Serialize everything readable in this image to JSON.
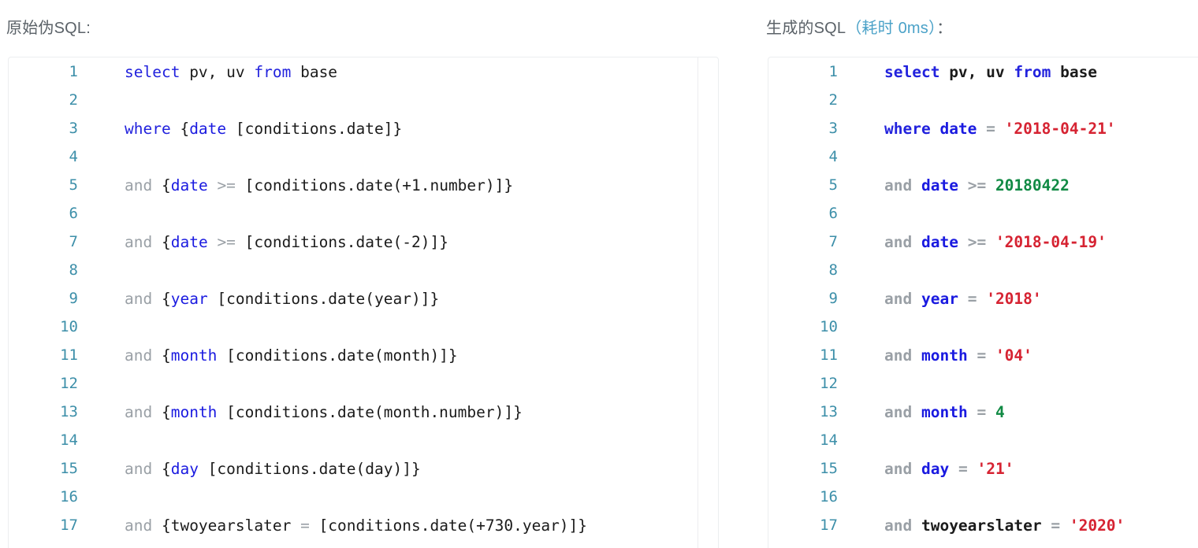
{
  "left_panel": {
    "title": "原始伪SQL：",
    "title_plain": "原始伪SQL:",
    "code_lines": [
      {
        "num": "1",
        "tokens": [
          {
            "t": "select",
            "c": "kw"
          },
          {
            "t": " pv, uv ",
            "c": "plain"
          },
          {
            "t": "from",
            "c": "kw"
          },
          {
            "t": " base",
            "c": "plain"
          }
        ]
      },
      {
        "num": "2",
        "tokens": []
      },
      {
        "num": "3",
        "tokens": [
          {
            "t": "where",
            "c": "kw"
          },
          {
            "t": " {",
            "c": "punc"
          },
          {
            "t": "date",
            "c": "field"
          },
          {
            "t": " [conditions.date]}",
            "c": "punc"
          }
        ]
      },
      {
        "num": "4",
        "tokens": []
      },
      {
        "num": "5",
        "tokens": [
          {
            "t": "and",
            "c": "and"
          },
          {
            "t": " {",
            "c": "punc"
          },
          {
            "t": "date",
            "c": "field"
          },
          {
            "t": " ",
            "c": "plain"
          },
          {
            "t": ">=",
            "c": "op"
          },
          {
            "t": " [conditions.date(+1.number)]}",
            "c": "punc"
          }
        ]
      },
      {
        "num": "6",
        "tokens": []
      },
      {
        "num": "7",
        "tokens": [
          {
            "t": "and",
            "c": "and"
          },
          {
            "t": " {",
            "c": "punc"
          },
          {
            "t": "date",
            "c": "field"
          },
          {
            "t": " ",
            "c": "plain"
          },
          {
            "t": ">=",
            "c": "op"
          },
          {
            "t": " [conditions.date(-2)]}",
            "c": "punc"
          }
        ]
      },
      {
        "num": "8",
        "tokens": []
      },
      {
        "num": "9",
        "tokens": [
          {
            "t": "and",
            "c": "and"
          },
          {
            "t": " {",
            "c": "punc"
          },
          {
            "t": "year",
            "c": "field"
          },
          {
            "t": " [conditions.date(year)]}",
            "c": "punc"
          }
        ]
      },
      {
        "num": "10",
        "tokens": []
      },
      {
        "num": "11",
        "tokens": [
          {
            "t": "and",
            "c": "and"
          },
          {
            "t": " {",
            "c": "punc"
          },
          {
            "t": "month",
            "c": "field"
          },
          {
            "t": " [conditions.date(month)]}",
            "c": "punc"
          }
        ]
      },
      {
        "num": "12",
        "tokens": []
      },
      {
        "num": "13",
        "tokens": [
          {
            "t": "and",
            "c": "and"
          },
          {
            "t": " {",
            "c": "punc"
          },
          {
            "t": "month",
            "c": "field"
          },
          {
            "t": " [conditions.date(month.number)]}",
            "c": "punc"
          }
        ]
      },
      {
        "num": "14",
        "tokens": []
      },
      {
        "num": "15",
        "tokens": [
          {
            "t": "and",
            "c": "and"
          },
          {
            "t": " {",
            "c": "punc"
          },
          {
            "t": "day",
            "c": "field"
          },
          {
            "t": " [conditions.date(day)]}",
            "c": "punc"
          }
        ]
      },
      {
        "num": "16",
        "tokens": []
      },
      {
        "num": "17",
        "tokens": [
          {
            "t": "and",
            "c": "and"
          },
          {
            "t": " {twoyearslater ",
            "c": "punc"
          },
          {
            "t": "=",
            "c": "op"
          },
          {
            "t": " [conditions.date(+730.year)]}",
            "c": "punc"
          }
        ]
      }
    ]
  },
  "right_panel": {
    "title_main": "生成的SQL",
    "title_accent": "（耗时 0ms）",
    "title_suffix": "：",
    "elapsed_ms": "0ms",
    "code_lines": [
      {
        "num": "1",
        "tokens": [
          {
            "t": "select",
            "c": "kw"
          },
          {
            "t": " pv, uv ",
            "c": "plain"
          },
          {
            "t": "from",
            "c": "kw"
          },
          {
            "t": " base",
            "c": "plain"
          }
        ]
      },
      {
        "num": "2",
        "tokens": []
      },
      {
        "num": "3",
        "tokens": [
          {
            "t": "where",
            "c": "kw"
          },
          {
            "t": " ",
            "c": "plain"
          },
          {
            "t": "date",
            "c": "field"
          },
          {
            "t": " ",
            "c": "plain"
          },
          {
            "t": "=",
            "c": "op"
          },
          {
            "t": " ",
            "c": "plain"
          },
          {
            "t": "'2018-04-21'",
            "c": "str"
          }
        ]
      },
      {
        "num": "4",
        "tokens": []
      },
      {
        "num": "5",
        "tokens": [
          {
            "t": "and",
            "c": "and"
          },
          {
            "t": " ",
            "c": "plain"
          },
          {
            "t": "date",
            "c": "field"
          },
          {
            "t": " ",
            "c": "plain"
          },
          {
            "t": ">=",
            "c": "op"
          },
          {
            "t": " ",
            "c": "plain"
          },
          {
            "t": "20180422",
            "c": "num"
          }
        ]
      },
      {
        "num": "6",
        "tokens": []
      },
      {
        "num": "7",
        "tokens": [
          {
            "t": "and",
            "c": "and"
          },
          {
            "t": " ",
            "c": "plain"
          },
          {
            "t": "date",
            "c": "field"
          },
          {
            "t": " ",
            "c": "plain"
          },
          {
            "t": ">=",
            "c": "op"
          },
          {
            "t": " ",
            "c": "plain"
          },
          {
            "t": "'2018-04-19'",
            "c": "str"
          }
        ]
      },
      {
        "num": "8",
        "tokens": []
      },
      {
        "num": "9",
        "tokens": [
          {
            "t": "and",
            "c": "and"
          },
          {
            "t": " ",
            "c": "plain"
          },
          {
            "t": "year",
            "c": "field"
          },
          {
            "t": " ",
            "c": "plain"
          },
          {
            "t": "=",
            "c": "op"
          },
          {
            "t": " ",
            "c": "plain"
          },
          {
            "t": "'2018'",
            "c": "str"
          }
        ]
      },
      {
        "num": "10",
        "tokens": []
      },
      {
        "num": "11",
        "tokens": [
          {
            "t": "and",
            "c": "and"
          },
          {
            "t": " ",
            "c": "plain"
          },
          {
            "t": "month",
            "c": "field"
          },
          {
            "t": " ",
            "c": "plain"
          },
          {
            "t": "=",
            "c": "op"
          },
          {
            "t": " ",
            "c": "plain"
          },
          {
            "t": "'04'",
            "c": "str"
          }
        ]
      },
      {
        "num": "12",
        "tokens": []
      },
      {
        "num": "13",
        "tokens": [
          {
            "t": "and",
            "c": "and"
          },
          {
            "t": " ",
            "c": "plain"
          },
          {
            "t": "month",
            "c": "field"
          },
          {
            "t": " ",
            "c": "plain"
          },
          {
            "t": "=",
            "c": "op"
          },
          {
            "t": " ",
            "c": "plain"
          },
          {
            "t": "4",
            "c": "num"
          }
        ]
      },
      {
        "num": "14",
        "tokens": []
      },
      {
        "num": "15",
        "tokens": [
          {
            "t": "and",
            "c": "and"
          },
          {
            "t": " ",
            "c": "plain"
          },
          {
            "t": "day",
            "c": "field"
          },
          {
            "t": " ",
            "c": "plain"
          },
          {
            "t": "=",
            "c": "op"
          },
          {
            "t": " ",
            "c": "plain"
          },
          {
            "t": "'21'",
            "c": "str"
          }
        ]
      },
      {
        "num": "16",
        "tokens": []
      },
      {
        "num": "17",
        "tokens": [
          {
            "t": "and",
            "c": "and"
          },
          {
            "t": " twoyearslater ",
            "c": "plain"
          },
          {
            "t": "=",
            "c": "op"
          },
          {
            "t": " ",
            "c": "plain"
          },
          {
            "t": "'2020'",
            "c": "str"
          }
        ]
      }
    ]
  },
  "colors": {
    "keyword": "#2222dd",
    "string": "#d62332",
    "number": "#118a44",
    "operator": "#9aa0a6",
    "line_number": "#3d8fa9",
    "title": "#5b6268",
    "accent": "#4ba2c8",
    "border": "#eceef0",
    "background": "#ffffff"
  }
}
